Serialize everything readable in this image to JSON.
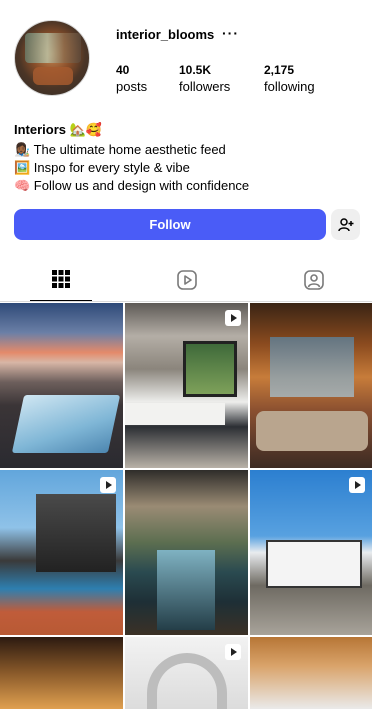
{
  "profile": {
    "username": "interior_blooms",
    "more_label": "···",
    "stats": [
      {
        "value": "40",
        "label": "posts"
      },
      {
        "value": "10.5K",
        "label": "followers"
      },
      {
        "value": "2,175",
        "label": "following"
      }
    ]
  },
  "bio": {
    "name": "Interiors 🏡🥰",
    "lines": [
      "👩🏾‍🎨 The ultimate home aesthetic feed",
      "🖼️ Inspo for every style & vibe",
      "🧠 Follow us and design with confidence"
    ]
  },
  "actions": {
    "follow_label": "Follow",
    "follow_color": "#4a5cf7"
  },
  "tabs": [
    {
      "name": "posts-grid",
      "icon": "grid-icon",
      "active": true
    },
    {
      "name": "reels",
      "icon": "reels-play-icon",
      "active": false
    },
    {
      "name": "tagged",
      "icon": "tagged-person-icon",
      "active": false
    }
  ],
  "posts": [
    {
      "subject": "rooftop-bed-sunset",
      "is_reel": false
    },
    {
      "subject": "kitchen-window",
      "is_reel": true
    },
    {
      "subject": "cozy-lounge-lights",
      "is_reel": false
    },
    {
      "subject": "modern-house-pool",
      "is_reel": true
    },
    {
      "subject": "courtyard-pool",
      "is_reel": false
    },
    {
      "subject": "tiny-house",
      "is_reel": true
    },
    {
      "subject": "a-frame-ceiling",
      "is_reel": false
    },
    {
      "subject": "white-arch",
      "is_reel": true
    },
    {
      "subject": "wood-ceiling",
      "is_reel": false
    }
  ]
}
